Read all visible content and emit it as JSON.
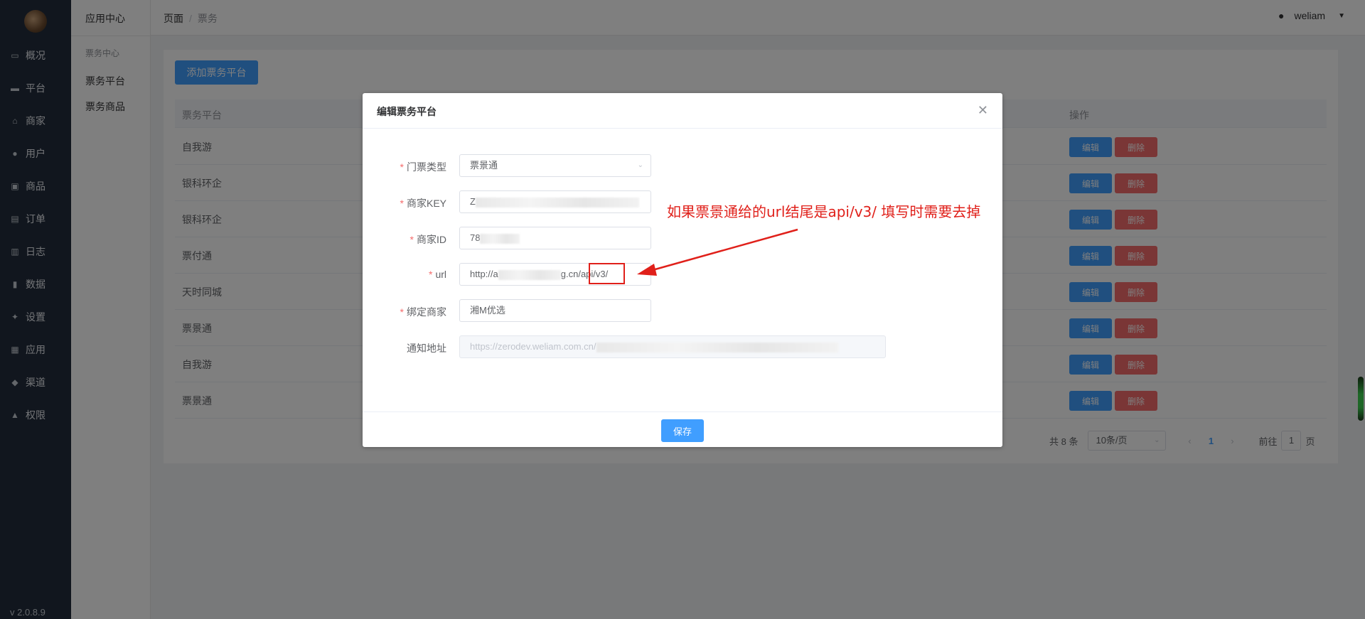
{
  "sidebar": {
    "items": [
      {
        "icon": "dashboard-icon",
        "glyph": "▭",
        "label": "概况"
      },
      {
        "icon": "monitor-icon",
        "glyph": "▬",
        "label": "平台"
      },
      {
        "icon": "store-icon",
        "glyph": "⌂",
        "label": "商家"
      },
      {
        "icon": "user-icon",
        "glyph": "●",
        "label": "用户"
      },
      {
        "icon": "goods-icon",
        "glyph": "▣",
        "label": "商品"
      },
      {
        "icon": "order-icon",
        "glyph": "▤",
        "label": "订单"
      },
      {
        "icon": "log-icon",
        "glyph": "▥",
        "label": "日志"
      },
      {
        "icon": "chart-icon",
        "glyph": "▮",
        "label": "数据"
      },
      {
        "icon": "gear-icon",
        "glyph": "✦",
        "label": "设置"
      },
      {
        "icon": "apps-icon",
        "glyph": "▦",
        "label": "应用"
      },
      {
        "icon": "channel-icon",
        "glyph": "◆",
        "label": "渠道"
      },
      {
        "icon": "lock-icon",
        "glyph": "▲",
        "label": "权限"
      }
    ],
    "version": "v 2.0.8.9"
  },
  "subnav": {
    "title": "应用中心",
    "group": "票务中心",
    "items": [
      "票务平台",
      "票务商品"
    ]
  },
  "topbar": {
    "breadcrumb": [
      "页面",
      "票务"
    ],
    "breadcrumb_sep": "/",
    "user": "weliam"
  },
  "main": {
    "add_button": "添加票务平台",
    "columns": {
      "platform": "票务平台",
      "action": "操作"
    },
    "rows": [
      "自我游",
      "银科环企",
      "银科环企",
      "票付通",
      "天时同城",
      "票景通",
      "自我游",
      "票景通"
    ],
    "edit_label": "编辑",
    "delete_label": "删除",
    "pager": {
      "total": "共 8 条",
      "page_size": "10条/页",
      "current": "1",
      "goto_prefix": "前往",
      "goto_value": "1",
      "goto_suffix": "页"
    }
  },
  "dialog": {
    "title": "编辑票务平台",
    "fields": {
      "ticket_type": {
        "label": "门票类型",
        "value": "票景通"
      },
      "merchant_key": {
        "label": "商家KEY",
        "value": "Z"
      },
      "merchant_id": {
        "label": "商家ID",
        "value": "78"
      },
      "url": {
        "label": "url",
        "value_start": "http://a",
        "value_mid": "g.cn/",
        "value_end": "api/v3/"
      },
      "bind_merchant": {
        "label": "绑定商家",
        "value": "湘M优选"
      },
      "notify_url": {
        "label": "通知地址",
        "value": "https://zerodev.weliam.com.cn/"
      }
    },
    "save_button": "保存"
  },
  "annotation": {
    "text": "如果票景通给的url结尾是api/v3/  填写时需要去掉",
    "color": "#e0201a"
  }
}
